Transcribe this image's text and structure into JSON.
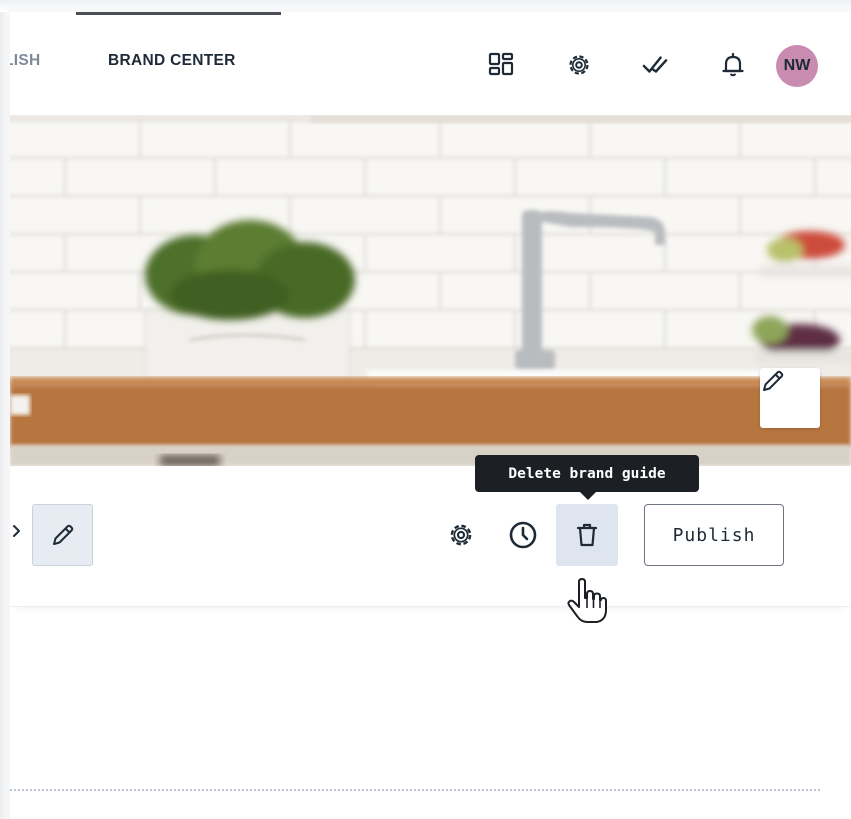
{
  "header": {
    "nav_prev_label": "LISH",
    "nav_active_label": "BRAND CENTER",
    "icons": [
      "apps-grid-icon",
      "gear-icon",
      "double-check-icon",
      "bell-icon"
    ],
    "avatar_initials": "NW",
    "avatar_color": "#c98cb0"
  },
  "hero": {
    "image": "kitchen-sink-photo",
    "edit_icon": "pencil-icon"
  },
  "toolbar": {
    "edit_icon": "pencil-icon",
    "icons": [
      "gear-icon",
      "clock-icon",
      "trash-icon"
    ],
    "publish_label": "Publish"
  },
  "tooltip": {
    "text": "Delete brand guide"
  },
  "colors": {
    "text_dark": "#1f2a37",
    "text_muted": "#7f8a99",
    "tooltip_bg": "#1c1f24",
    "active_button_bg": "#dfe5ee"
  }
}
